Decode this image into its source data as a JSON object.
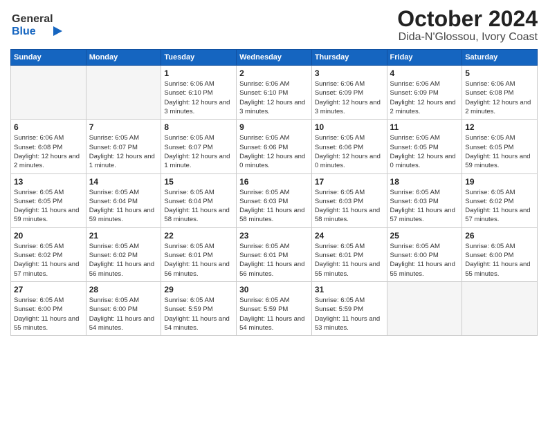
{
  "header": {
    "logo_general": "General",
    "logo_blue": "Blue",
    "title": "October 2024",
    "subtitle": "Dida-N'Glossou, Ivory Coast"
  },
  "weekdays": [
    "Sunday",
    "Monday",
    "Tuesday",
    "Wednesday",
    "Thursday",
    "Friday",
    "Saturday"
  ],
  "weeks": [
    [
      {
        "day": "",
        "empty": true
      },
      {
        "day": "",
        "empty": true
      },
      {
        "day": "1",
        "sunrise": "Sunrise: 6:06 AM",
        "sunset": "Sunset: 6:10 PM",
        "daylight": "Daylight: 12 hours and 3 minutes."
      },
      {
        "day": "2",
        "sunrise": "Sunrise: 6:06 AM",
        "sunset": "Sunset: 6:10 PM",
        "daylight": "Daylight: 12 hours and 3 minutes."
      },
      {
        "day": "3",
        "sunrise": "Sunrise: 6:06 AM",
        "sunset": "Sunset: 6:09 PM",
        "daylight": "Daylight: 12 hours and 3 minutes."
      },
      {
        "day": "4",
        "sunrise": "Sunrise: 6:06 AM",
        "sunset": "Sunset: 6:09 PM",
        "daylight": "Daylight: 12 hours and 2 minutes."
      },
      {
        "day": "5",
        "sunrise": "Sunrise: 6:06 AM",
        "sunset": "Sunset: 6:08 PM",
        "daylight": "Daylight: 12 hours and 2 minutes."
      }
    ],
    [
      {
        "day": "6",
        "sunrise": "Sunrise: 6:06 AM",
        "sunset": "Sunset: 6:08 PM",
        "daylight": "Daylight: 12 hours and 2 minutes."
      },
      {
        "day": "7",
        "sunrise": "Sunrise: 6:05 AM",
        "sunset": "Sunset: 6:07 PM",
        "daylight": "Daylight: 12 hours and 1 minute."
      },
      {
        "day": "8",
        "sunrise": "Sunrise: 6:05 AM",
        "sunset": "Sunset: 6:07 PM",
        "daylight": "Daylight: 12 hours and 1 minute."
      },
      {
        "day": "9",
        "sunrise": "Sunrise: 6:05 AM",
        "sunset": "Sunset: 6:06 PM",
        "daylight": "Daylight: 12 hours and 0 minutes."
      },
      {
        "day": "10",
        "sunrise": "Sunrise: 6:05 AM",
        "sunset": "Sunset: 6:06 PM",
        "daylight": "Daylight: 12 hours and 0 minutes."
      },
      {
        "day": "11",
        "sunrise": "Sunrise: 6:05 AM",
        "sunset": "Sunset: 6:05 PM",
        "daylight": "Daylight: 12 hours and 0 minutes."
      },
      {
        "day": "12",
        "sunrise": "Sunrise: 6:05 AM",
        "sunset": "Sunset: 6:05 PM",
        "daylight": "Daylight: 11 hours and 59 minutes."
      }
    ],
    [
      {
        "day": "13",
        "sunrise": "Sunrise: 6:05 AM",
        "sunset": "Sunset: 6:05 PM",
        "daylight": "Daylight: 11 hours and 59 minutes."
      },
      {
        "day": "14",
        "sunrise": "Sunrise: 6:05 AM",
        "sunset": "Sunset: 6:04 PM",
        "daylight": "Daylight: 11 hours and 59 minutes."
      },
      {
        "day": "15",
        "sunrise": "Sunrise: 6:05 AM",
        "sunset": "Sunset: 6:04 PM",
        "daylight": "Daylight: 11 hours and 58 minutes."
      },
      {
        "day": "16",
        "sunrise": "Sunrise: 6:05 AM",
        "sunset": "Sunset: 6:03 PM",
        "daylight": "Daylight: 11 hours and 58 minutes."
      },
      {
        "day": "17",
        "sunrise": "Sunrise: 6:05 AM",
        "sunset": "Sunset: 6:03 PM",
        "daylight": "Daylight: 11 hours and 58 minutes."
      },
      {
        "day": "18",
        "sunrise": "Sunrise: 6:05 AM",
        "sunset": "Sunset: 6:03 PM",
        "daylight": "Daylight: 11 hours and 57 minutes."
      },
      {
        "day": "19",
        "sunrise": "Sunrise: 6:05 AM",
        "sunset": "Sunset: 6:02 PM",
        "daylight": "Daylight: 11 hours and 57 minutes."
      }
    ],
    [
      {
        "day": "20",
        "sunrise": "Sunrise: 6:05 AM",
        "sunset": "Sunset: 6:02 PM",
        "daylight": "Daylight: 11 hours and 57 minutes."
      },
      {
        "day": "21",
        "sunrise": "Sunrise: 6:05 AM",
        "sunset": "Sunset: 6:02 PM",
        "daylight": "Daylight: 11 hours and 56 minutes."
      },
      {
        "day": "22",
        "sunrise": "Sunrise: 6:05 AM",
        "sunset": "Sunset: 6:01 PM",
        "daylight": "Daylight: 11 hours and 56 minutes."
      },
      {
        "day": "23",
        "sunrise": "Sunrise: 6:05 AM",
        "sunset": "Sunset: 6:01 PM",
        "daylight": "Daylight: 11 hours and 56 minutes."
      },
      {
        "day": "24",
        "sunrise": "Sunrise: 6:05 AM",
        "sunset": "Sunset: 6:01 PM",
        "daylight": "Daylight: 11 hours and 55 minutes."
      },
      {
        "day": "25",
        "sunrise": "Sunrise: 6:05 AM",
        "sunset": "Sunset: 6:00 PM",
        "daylight": "Daylight: 11 hours and 55 minutes."
      },
      {
        "day": "26",
        "sunrise": "Sunrise: 6:05 AM",
        "sunset": "Sunset: 6:00 PM",
        "daylight": "Daylight: 11 hours and 55 minutes."
      }
    ],
    [
      {
        "day": "27",
        "sunrise": "Sunrise: 6:05 AM",
        "sunset": "Sunset: 6:00 PM",
        "daylight": "Daylight: 11 hours and 55 minutes."
      },
      {
        "day": "28",
        "sunrise": "Sunrise: 6:05 AM",
        "sunset": "Sunset: 6:00 PM",
        "daylight": "Daylight: 11 hours and 54 minutes."
      },
      {
        "day": "29",
        "sunrise": "Sunrise: 6:05 AM",
        "sunset": "Sunset: 5:59 PM",
        "daylight": "Daylight: 11 hours and 54 minutes."
      },
      {
        "day": "30",
        "sunrise": "Sunrise: 6:05 AM",
        "sunset": "Sunset: 5:59 PM",
        "daylight": "Daylight: 11 hours and 54 minutes."
      },
      {
        "day": "31",
        "sunrise": "Sunrise: 6:05 AM",
        "sunset": "Sunset: 5:59 PM",
        "daylight": "Daylight: 11 hours and 53 minutes."
      },
      {
        "day": "",
        "empty": true
      },
      {
        "day": "",
        "empty": true
      }
    ]
  ]
}
